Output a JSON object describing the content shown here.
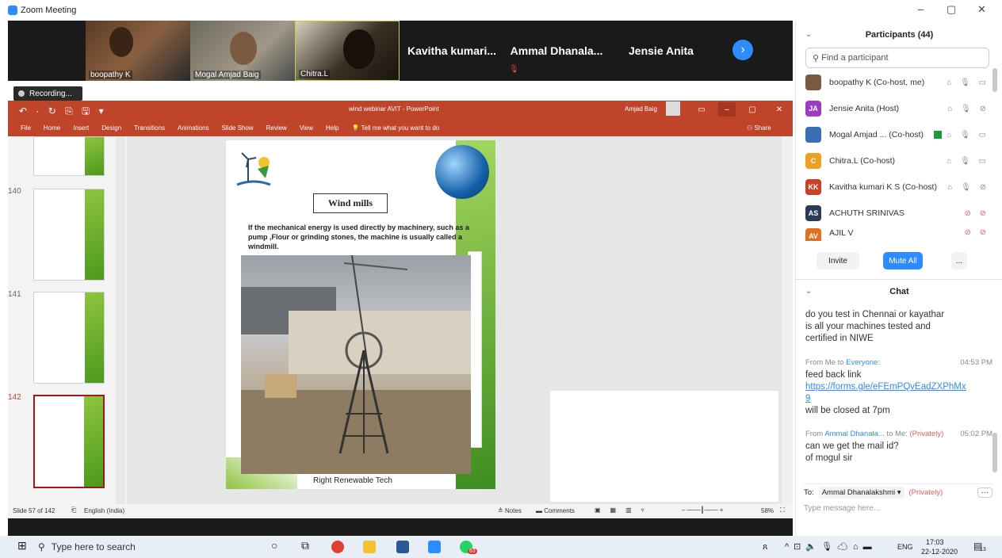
{
  "window": {
    "title": "Zoom Meeting"
  },
  "videos": [
    {
      "name": "boopathy K"
    },
    {
      "name": "Mogal Amjad Baig"
    },
    {
      "name": "Chitra.L"
    }
  ],
  "name_tiles": [
    "Kavitha  kumari...",
    "Ammal  Dhanala...",
    "Jensie Anita"
  ],
  "recording": "Recording...",
  "ppt": {
    "doc_title": "wind webinar AVIT - PowerPoint",
    "user": "Amjad Baig",
    "quick_access": "↶ · ↻ ⎘ 🖫 ▾",
    "tabs": [
      "File",
      "Home",
      "Insert",
      "Design",
      "Transitions",
      "Animations",
      "Slide Show",
      "Review",
      "View",
      "Help",
      "Tell me what you want to do"
    ],
    "share": "Share",
    "thumb_numbers": [
      "140",
      "141",
      "142"
    ],
    "status_left": "Slide 57 of 142",
    "language": "English (India)",
    "notes": "Notes",
    "comments": "Comments",
    "zoom": "58%"
  },
  "slide": {
    "title": "Wind mills",
    "body": "If the mechanical  energy is used directly  by machinery, such as a pump ,Flour or grinding  stones, the machine is usually called a  windmill.",
    "caption": "Right Renewable Tech"
  },
  "participants": {
    "header": "Participants (44)",
    "search_placeholder": "Find a participant",
    "list": [
      {
        "initials": "",
        "name": "boopathy K (Co-host, me)",
        "color": "#7a5a40",
        "icons": "⌂ 🎙 ▭"
      },
      {
        "initials": "JA",
        "name": "Jensie Anita (Host)",
        "color": "#9b3dc4",
        "icons": "⌂ 🎙 ⊘"
      },
      {
        "initials": "",
        "name": "Mogal Amjad ...  (Co-host)",
        "color": "#3b6fb5",
        "icons": "⌂ 🎙 ▭"
      },
      {
        "initials": "C",
        "name": "Chitra.L (Co-host)",
        "color": "#f0a020",
        "icons": "⌂ 🎙 ▭"
      },
      {
        "initials": "KK",
        "name": "Kavitha kumari K S (Co-host)",
        "color": "#c8402a",
        "icons": "⌂ 🎙 ⊘"
      },
      {
        "initials": "AS",
        "name": "ACHUTH SRINIVAS",
        "color": "#2a3c58",
        "icons": "⊘ ⊘"
      },
      {
        "initials": "AV",
        "name": "AJIL V",
        "color": "#e07020",
        "icons": "⊘ ⊘"
      }
    ],
    "invite": "Invite",
    "mute_all": "Mute All",
    "more": "..."
  },
  "chat": {
    "header": "Chat",
    "lines1": [
      "do you test in Chennai or kayathar",
      "is all your machines tested  and",
      "certified in NIWE"
    ],
    "msg2": {
      "from": "From Me to ",
      "to": "Everyone:",
      "time": "04:53 PM",
      "line1": "feed back link",
      "link": "https://forms.gle/eFEmPQvEadZXPhMx9",
      "line2": "will be closed at 7pm"
    },
    "msg3": {
      "from": "From ",
      "sender": "Ammal Dhanala...",
      "to": " to Me: ",
      "priv": "(Privately)",
      "time": "05:02 PM",
      "line1": "can we get the mail id?",
      "line2": "of mogul sir"
    },
    "to_label": "To:",
    "to_target": "Ammal Dhanalakshmi ▾",
    "to_priv": "(Privately)",
    "placeholder": "Type message here..."
  },
  "taskbar": {
    "search": "Type here to search",
    "lang": "ENG",
    "time": "17:03",
    "date": "22-12-2020",
    "badge": "63",
    "notif": "13"
  }
}
